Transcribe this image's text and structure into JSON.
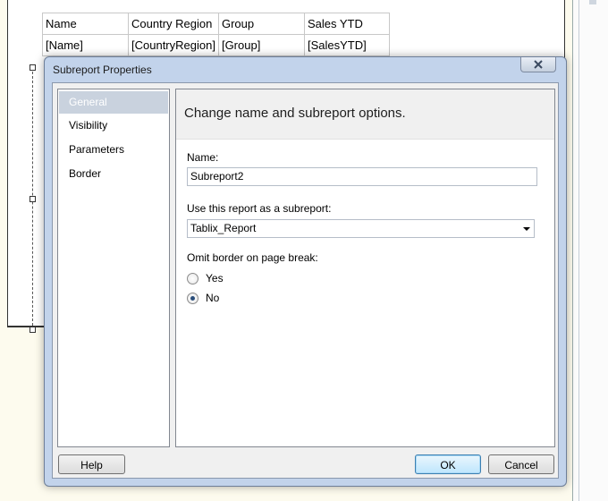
{
  "report": {
    "tablix": {
      "headers": [
        "Name",
        "Country Region",
        "Group",
        "Sales YTD"
      ],
      "row": [
        "[Name]",
        "[CountryRegion]",
        "[Group]",
        "[SalesYTD]"
      ]
    }
  },
  "dialog": {
    "title": "Subreport Properties",
    "nav_items": [
      "General",
      "Visibility",
      "Parameters",
      "Border"
    ],
    "selected_nav": "General",
    "panel_title": "Change name and subreport options.",
    "name_label": "Name:",
    "name_value": "Subreport2",
    "report_label": "Use this report as a subreport:",
    "report_value": "Tablix_Report",
    "omit_label": "Omit border on page break:",
    "options": [
      {
        "label": "Yes",
        "checked": false
      },
      {
        "label": "No",
        "checked": true
      }
    ],
    "help_button": "Help",
    "ok_button": "OK",
    "cancel_button": "Cancel"
  },
  "colors": {
    "dialog_frame": "#c2d3eb",
    "selected_nav": "#c9d2de",
    "background": "#fdfbee"
  }
}
